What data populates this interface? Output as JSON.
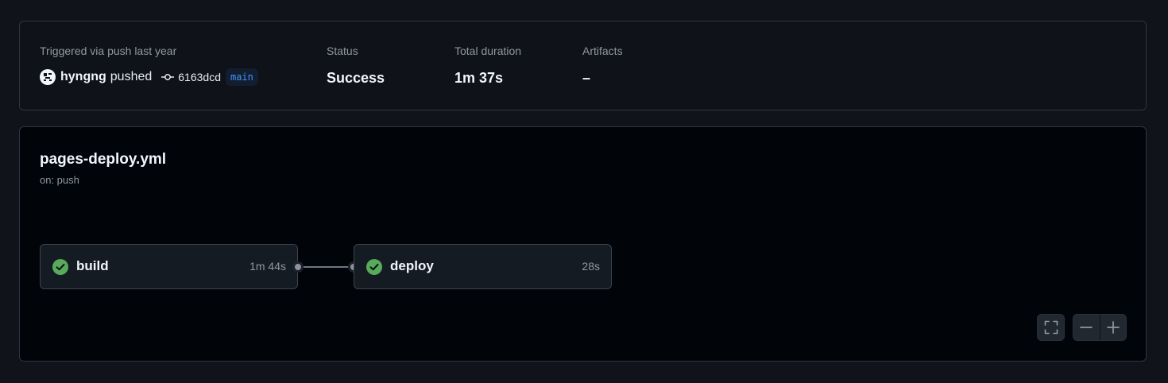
{
  "run_summary": {
    "trigger_label": "Triggered via push last year",
    "actor": "hyngng",
    "verb": "pushed",
    "commit_sha": "6163dcd",
    "branch": "main",
    "status_label": "Status",
    "status_value": "Success",
    "duration_label": "Total duration",
    "duration_value": "1m 37s",
    "artifacts_label": "Artifacts",
    "artifacts_value": "–"
  },
  "workflow": {
    "file_name": "pages-deploy.yml",
    "trigger": "on: push",
    "jobs": [
      {
        "name": "build",
        "duration": "1m 44s",
        "status": "success"
      },
      {
        "name": "deploy",
        "duration": "28s",
        "status": "success"
      }
    ]
  },
  "controls": {
    "fullscreen_icon": "fullscreen-icon",
    "zoom_out_icon": "zoom-out-icon",
    "zoom_in_icon": "zoom-in-icon"
  },
  "colors": {
    "success": "#57ab5a",
    "accent_link": "#4493f8",
    "background": "#010409"
  }
}
